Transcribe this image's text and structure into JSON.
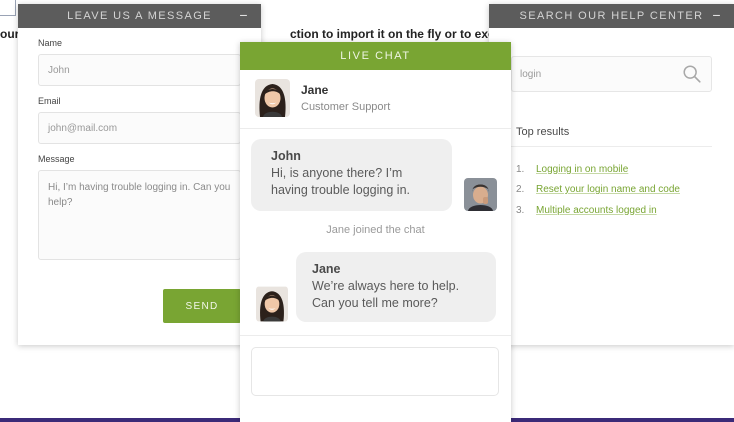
{
  "background": {
    "left_text": "our",
    "middle_text": "ction to import it on the fly or to excha"
  },
  "message_widget": {
    "title": "LEAVE US A MESSAGE",
    "minimize": "−",
    "name_label": "Name",
    "name_value": "John",
    "email_label": "Email",
    "email_value": "john@mail.com",
    "message_label": "Message",
    "message_value": "Hi, I’m having trouble logging in. Can you help?",
    "send_label": "SEND"
  },
  "help_widget": {
    "title": "SEARCH OUR HELP CENTER",
    "minimize": "−",
    "search_value": "login",
    "results_heading": "Top results",
    "results": [
      {
        "num": "1.",
        "text": "Logging in on mobile"
      },
      {
        "num": "2.",
        "text": "Reset your login name and code"
      },
      {
        "num": "3.",
        "text": "Multiple accounts logged in"
      }
    ]
  },
  "chat_widget": {
    "title": "LIVE CHAT",
    "agent_name": "Jane",
    "agent_role": "Customer Support",
    "messages": [
      {
        "author": "John",
        "text": "Hi, is anyone there? I’m having trouble logging in."
      },
      {
        "author": "Jane",
        "text": "We’re always here to help. Can you tell me more?"
      }
    ],
    "system_note": "Jane joined the chat"
  },
  "colors": {
    "accent": "#79a533",
    "header_gray": "#5c5c5c",
    "bottom_bar": "#3b2a78"
  },
  "icons": [
    "search-icon",
    "minimize-icon",
    "avatar-jane",
    "avatar-john"
  ]
}
